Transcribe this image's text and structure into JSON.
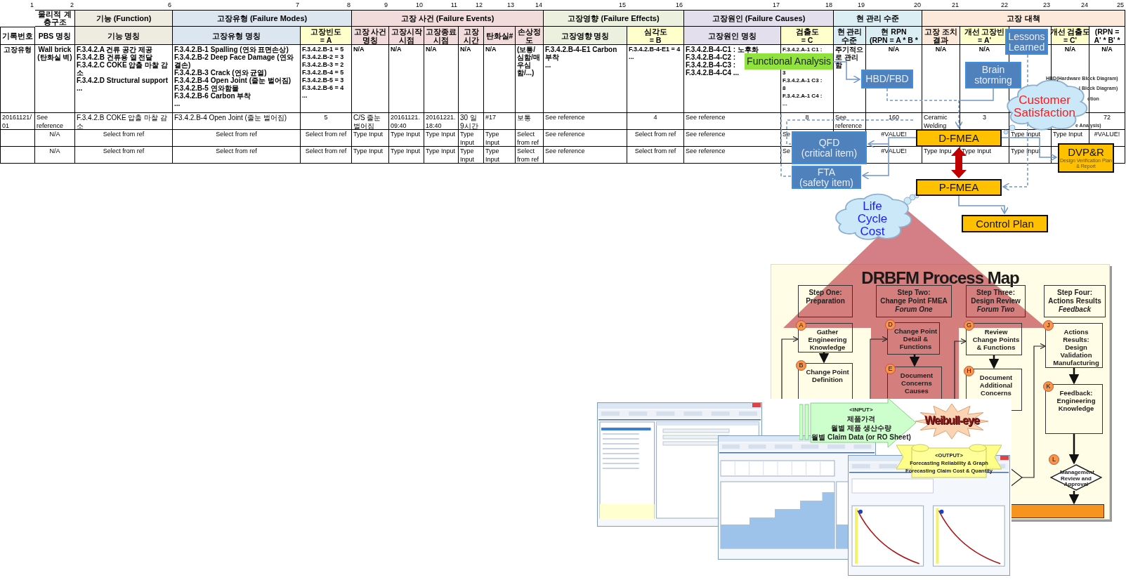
{
  "table": {
    "groups": [
      {
        "label": "물리적 계층구조",
        "color": "#ffffff"
      },
      {
        "label": "기능 (Function)",
        "color": "#eeece1"
      },
      {
        "label": "고장유형 (Failure Modes)",
        "color": "#dce6f1"
      },
      {
        "label": "고장 사건 (Failure Events)",
        "color": "#f2dcdb"
      },
      {
        "label": "고장영향 (Failure Effects)",
        "color": "#ebf1de"
      },
      {
        "label": "고장원인 (Failure Causes)",
        "color": "#e4dfec"
      },
      {
        "label": "현 관리 수준",
        "color": "#daeef3"
      },
      {
        "label": "고장 대책",
        "color": "#fde9d9"
      }
    ],
    "columns": [
      {
        "number": "1",
        "header": [
          "기록번호"
        ],
        "color": "#ffffff"
      },
      {
        "number": "2",
        "header": [
          "PBS 명칭"
        ],
        "color": "#ffffff"
      },
      {
        "number": "6",
        "header": [
          "기능 명칭"
        ],
        "color": "#eeece1"
      },
      {
        "number": "7",
        "header": [
          "고장유형 명칭"
        ],
        "color": "#dce6f1"
      },
      {
        "number": "8",
        "header": [
          "고장빈도",
          "= A"
        ],
        "color": "#ffffcc"
      },
      {
        "number": "9",
        "header": [
          "고장 사건",
          "명칭"
        ],
        "color": "#f2dcdb"
      },
      {
        "number": "10",
        "header": [
          "고장시작",
          "시점"
        ],
        "color": "#f2dcdb"
      },
      {
        "number": "11",
        "header": [
          "고장종료",
          "시점"
        ],
        "color": "#f2dcdb"
      },
      {
        "number": "12",
        "header": [
          "고장",
          "시간"
        ],
        "color": "#f2dcdb"
      },
      {
        "number": "13",
        "header": [
          "탄화실#"
        ],
        "color": "#f2dcdb"
      },
      {
        "number": "14",
        "header": [
          "손상정",
          "도"
        ],
        "color": "#f2dcdb"
      },
      {
        "number": "15",
        "header": [
          "고장영향 명칭"
        ],
        "color": "#ebf1de"
      },
      {
        "number": "16",
        "header": [
          "심각도",
          "= B"
        ],
        "color": "#ffffcc"
      },
      {
        "number": "17",
        "header": [
          "고장원인 명칭"
        ],
        "color": "#e4dfec"
      },
      {
        "number": "18",
        "header": [
          "검출도",
          "= C"
        ],
        "color": "#ffffcc"
      },
      {
        "number": "19",
        "header": [
          "현 관리",
          "수준"
        ],
        "color": "#daeef3"
      },
      {
        "number": "20",
        "header": [
          "현 RPN",
          "(RPN = A * B *"
        ],
        "color": "#daeef3"
      },
      {
        "number": "21",
        "header": [
          "고장 조치",
          "결과"
        ],
        "color": "#fde9d9"
      },
      {
        "number": "22",
        "header": [
          "개선 고장빈",
          "= A'"
        ],
        "color": "#ffffcc"
      },
      {
        "number": "23"
      },
      {
        "number": "24",
        "header": [
          "개선 검출도",
          "= C'"
        ],
        "color": "#ffffcc"
      },
      {
        "number": "25",
        "header": [
          "(RPN =",
          "A' * B' *"
        ],
        "color": "#ffffff"
      }
    ],
    "rows": [
      {
        "cells": [
          "고장유형",
          [
            "Wall brick",
            "(탄화실 벽)"
          ],
          [
            "F.3.4.2.A 건류 공간 제공",
            "F.3.4.2.B 건류용 열 전달",
            "F.3.4.2.C COKE 압출 마찰 감소",
            "F.3.4.2.D Structural support",
            "..."
          ],
          [
            "F.3.4.2.B-1 Spalling (연와 표면손상)",
            "F.3.4.2.B-2 Deep Face Damage (연와 결손)",
            "F.3.4.2.B-3 Crack (연와 균열)",
            "F.3.4.2.B-4 Open Joint (줄눈 벌어짐)",
            "F.3.4.2.B-5 연와함몰",
            "F.3.4.2.B-6 Carbon 부착",
            "..."
          ],
          [
            "F.3.4.2.B-1 = 5",
            "F.3.4.2.B-2 = 3",
            "F.3.4.2.B-3 = 2",
            "F.3.4.2.B-4 = 5",
            "F.3.4.2.B-5 = 3",
            "F.3.4.2.B-6 = 4",
            "..."
          ],
          "N/A",
          "N/A",
          "N/A",
          "N/A",
          "N/A",
          "(보통/심함/매우심함/...)",
          [
            "F.3.4.2.B-4-E1 Carbon 부착",
            "..."
          ],
          [
            "F.3.4.2.B-4-E1 = 4",
            "..."
          ],
          [
            "F.3.4.2.B-4-C1 : 노후화",
            "F.3.4.2.B-4-C2 :",
            "F.3.4.2.B-4-C3 :",
            "F.3.4.2.B-4-C4 ..."
          ],
          [
            "F.3.4.2.A-1 C1 :",
            "3",
            "F.3.4.2.A-1 C3 :",
            "8",
            "F.3.4.2.A-1 C4 :",
            "..."
          ],
          "주기적으로 관리함",
          "N/A",
          "N/A",
          "N/A",
          null,
          "N/A",
          "N/A"
        ]
      },
      {
        "cells": [
          "20161121/01",
          "See reference",
          "F.3.4.2.B COKE 압출 마찰 감소",
          "F3.4.2.B-4 Open Joint (줄눈 벌어짐)",
          "5",
          "C/S 줄눈벌어짐",
          "20161121.09:40",
          "20161221.18:40",
          "30 일 9시간",
          "#17",
          "보통",
          "See reference",
          "4",
          "See reference",
          "8",
          "See reference",
          "160",
          "Ceramic Welding",
          "3",
          null,
          null,
          "72"
        ]
      },
      {
        "cells": [
          null,
          "N/A",
          "Select from ref",
          "Select from ref",
          "Select from ref",
          "Type Input",
          "Type Input",
          "Type Input",
          "Type Input",
          "Type Input",
          "Select from ref",
          "See reference",
          "Select from ref",
          "See reference",
          "Se",
          null,
          "#VALUE!",
          null,
          null,
          "Type Input",
          "Type Input",
          "#VALUE!"
        ]
      },
      {
        "cells": [
          null,
          "N/A",
          "Select from ref",
          "Select from ref",
          "Select from ref",
          "Type Input",
          "Type Input",
          "Type Input",
          "Type Input",
          "Type Input",
          "Select from ref",
          "See reference",
          "Select from ref",
          "See reference",
          "Se",
          null,
          "#VALUE!",
          "Type Inpu",
          "Type Input",
          "Type Input",
          null,
          null
        ]
      }
    ]
  },
  "diagram": {
    "boxes": [
      {
        "kind": "green",
        "lines": [
          "Functional Analysis"
        ]
      },
      {
        "kind": "blue",
        "lines": [
          "HBD/FBD"
        ]
      },
      {
        "kind": "blue",
        "lines": [
          "Lessons",
          "Learned"
        ]
      },
      {
        "kind": "blue",
        "lines": [
          "Brain",
          "storming"
        ]
      },
      {
        "kind": "orange",
        "lines": [
          "D-FMEA"
        ]
      },
      {
        "kind": "blue",
        "lines": [
          "QFD",
          "(critical item)"
        ]
      },
      {
        "kind": "blue",
        "lines": [
          "FTA",
          "(safety item)"
        ]
      },
      {
        "kind": "orange",
        "lines": [
          "P-FMEA"
        ]
      },
      {
        "kind": "orange",
        "lines": [
          "DVP&R"
        ],
        "subtitle": "Design Verification Plan & Report"
      },
      {
        "kind": "orange",
        "lines": [
          "Control Plan"
        ]
      }
    ],
    "clouds": [
      {
        "lines": [
          "Customer",
          "Satisfaction"
        ],
        "color": "#ff1a1a"
      },
      {
        "lines": [
          "Life",
          "Cycle",
          "Cost"
        ],
        "color": "#1a1aff"
      }
    ],
    "notes": [
      "HBD(Hardware Block Diagram)",
      "l Block Diagram)",
      "ction",
      "e Analysis)"
    ]
  },
  "process_map": {
    "title": "DRBFM Process Map",
    "steps": [
      {
        "title": "Step One:",
        "name": "Preparation"
      },
      {
        "title": "Step Two:",
        "name": "Change Point FMEA",
        "forum": "Forum One"
      },
      {
        "title": "Step Three:",
        "name": "Design Review",
        "forum": "Forum Two"
      },
      {
        "title": "Step Four:",
        "name": "Actions Results",
        "forum": "Feedback"
      }
    ],
    "nodes": [
      {
        "kind": "box",
        "letter": "A",
        "label": "Gather Engineering Knowledge"
      },
      {
        "kind": "box",
        "letter": "B",
        "label": "Change Point Definition"
      },
      {
        "kind": "box",
        "letter": "D",
        "label": "Change Point Detail & Functions"
      },
      {
        "kind": "box",
        "letter": "E",
        "label": "Document Concerns Causes"
      },
      {
        "kind": "box",
        "letter": "G",
        "label": "Review Change Points & Functions"
      },
      {
        "kind": "box",
        "letter": "H",
        "label": "Document Additional Concerns"
      },
      {
        "kind": "box",
        "letter": "J",
        "label": "Actions Results: Design Validation Manufacturing"
      },
      {
        "kind": "box",
        "letter": "K",
        "label": "Feedback: Engineering Knowledge"
      },
      {
        "kind": "diamond",
        "letter": "L",
        "label": "Management Review and Approval"
      }
    ]
  },
  "collage": {
    "input": {
      "title": "<INPUT>",
      "lines": [
        "제품가격",
        "월별 제품 생산수량",
        "월별 Claim Data (or RO Sheet)"
      ]
    },
    "logo": "Weibull-eye",
    "output": {
      "title": "<OUTPUT>",
      "lines": [
        "Forecasting Reliability & Graph",
        "Forecasting Claim Cost & Quantity"
      ]
    },
    "windows": [
      {
        "kind": "form"
      },
      {
        "kind": "table"
      },
      {
        "kind": "chart"
      }
    ]
  }
}
